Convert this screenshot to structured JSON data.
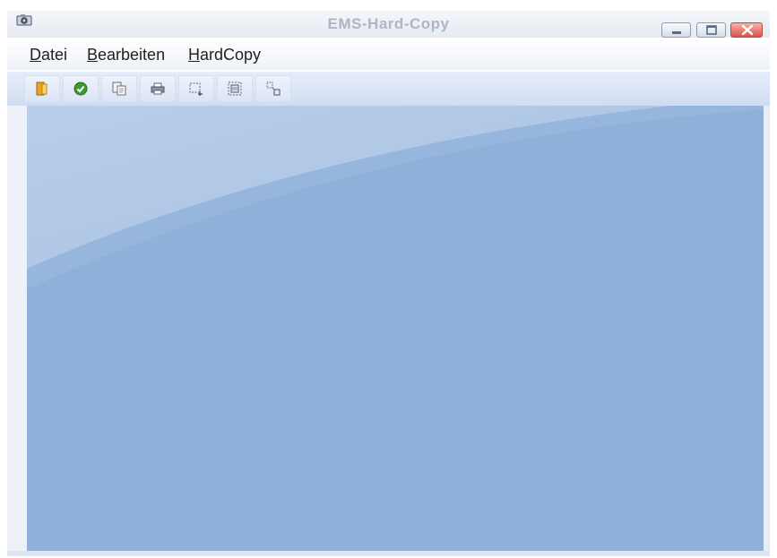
{
  "window": {
    "title": "EMS-Hard-Copy",
    "app_icon": "camera-icon",
    "controls": [
      "minimize-icon",
      "maximize-icon",
      "close-icon"
    ]
  },
  "menubar": {
    "items": [
      {
        "label": "Datei",
        "mnemonic": "D",
        "rest": "atei"
      },
      {
        "label": "Bearbeiten",
        "mnemonic": "B",
        "rest": "earbeiten"
      },
      {
        "label": "HardCopy",
        "mnemonic": "H",
        "rest": "ardCopy"
      }
    ]
  },
  "toolbar": {
    "buttons": [
      "open-folder-icon",
      "ok-check-icon",
      "copy-document-icon",
      "print-icon",
      "select-region-icon",
      "select-frame-icon",
      "select-object-icon"
    ]
  },
  "colors": {
    "workspace_light": "#b9cfe9",
    "workspace_dark": "#8eb0d9",
    "check_green": "#3e9a2c",
    "close_button": "#d9534f"
  }
}
